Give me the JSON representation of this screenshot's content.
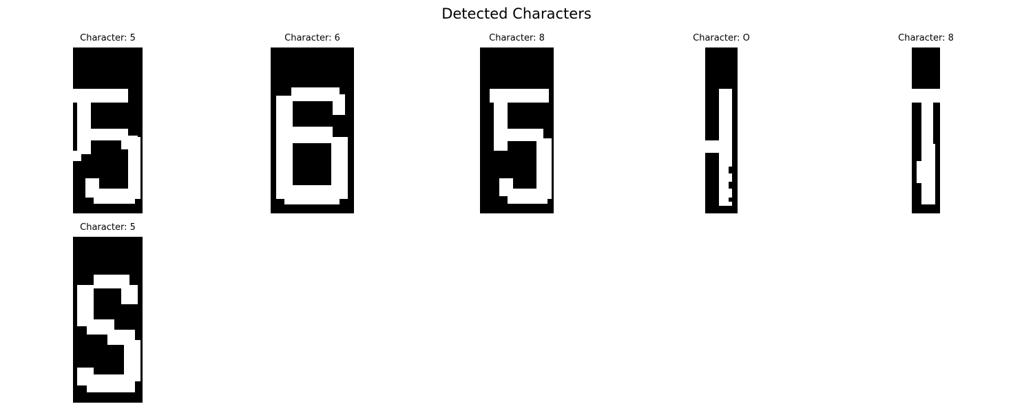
{
  "figure": {
    "title": "Detected Characters"
  },
  "panels": [
    {
      "label": "Character: 5",
      "depicted_glyph": "5"
    },
    {
      "label": "Character: 6",
      "depicted_glyph": "6"
    },
    {
      "label": "Character: 8",
      "depicted_glyph": "5"
    },
    {
      "label": "Character: O",
      "depicted_glyph": "vertical-bar"
    },
    {
      "label": "Character: 8",
      "depicted_glyph": "vertical-bar"
    },
    {
      "label": "Character: 5",
      "depicted_glyph": "S"
    }
  ],
  "colors": {
    "background": "#000000",
    "foreground": "#ffffff"
  }
}
